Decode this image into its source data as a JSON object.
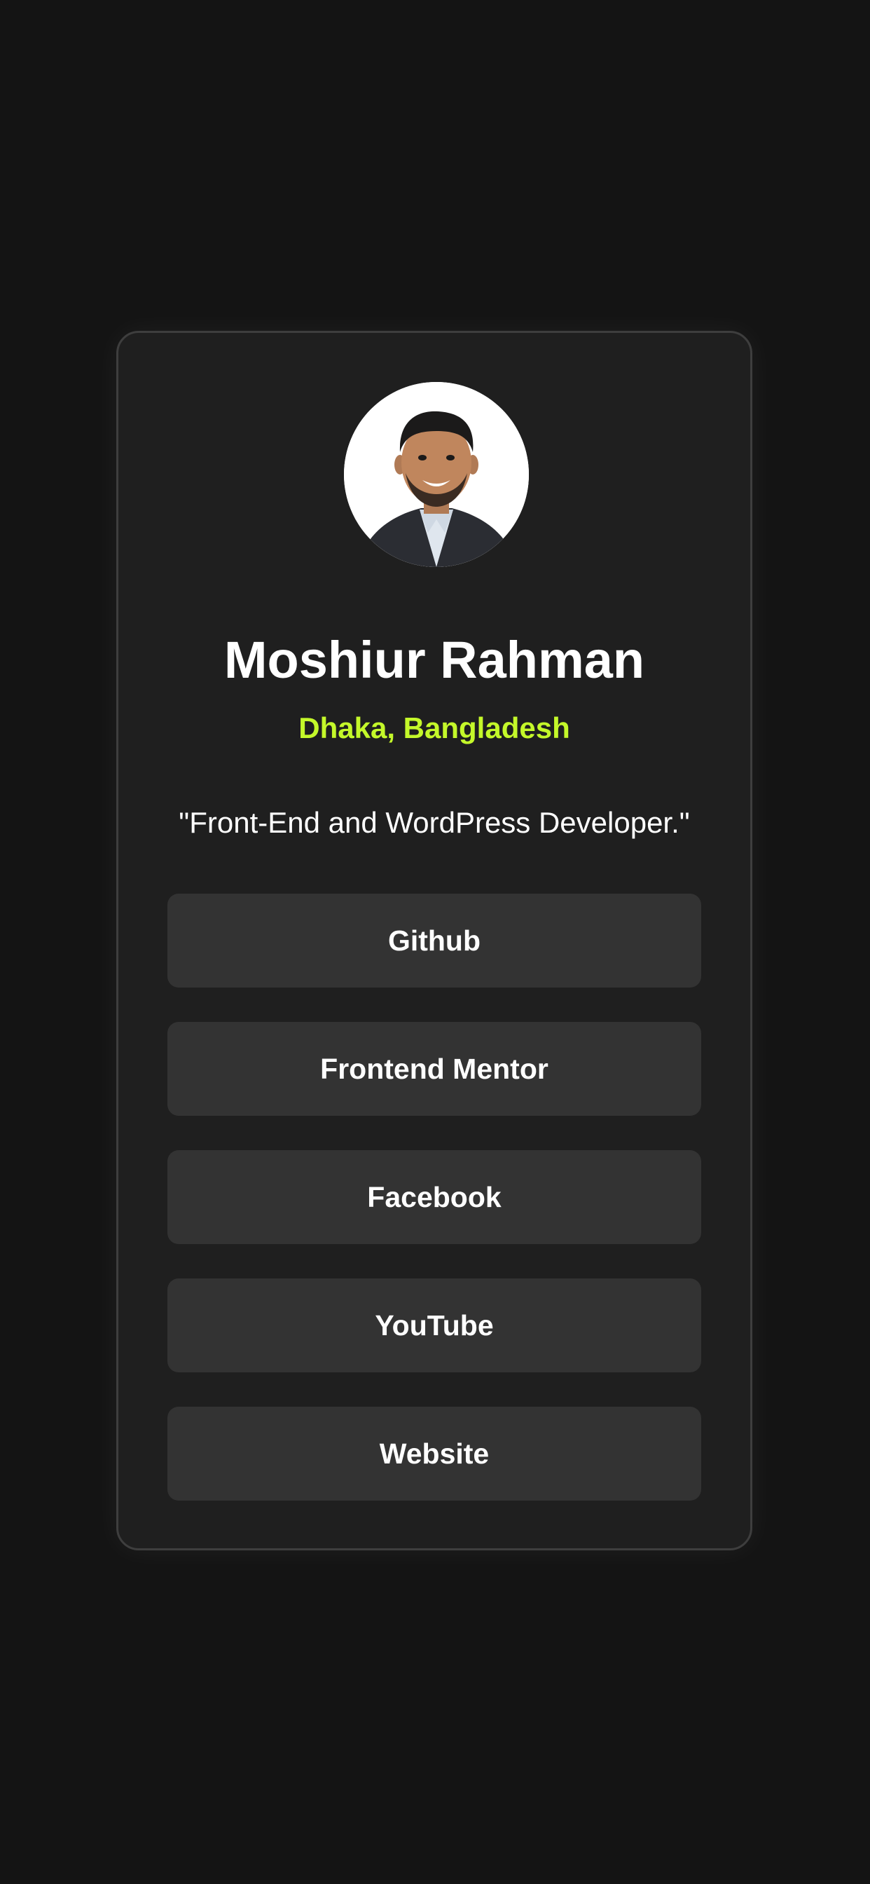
{
  "profile": {
    "name": "Moshiur Rahman",
    "location": "Dhaka, Bangladesh",
    "bio": "\"Front-End and WordPress Developer.\""
  },
  "links": [
    {
      "label": "Github"
    },
    {
      "label": "Frontend Mentor"
    },
    {
      "label": "Facebook"
    },
    {
      "label": "YouTube"
    },
    {
      "label": "Website"
    }
  ],
  "colors": {
    "background": "#141414",
    "card": "#1f1f1f",
    "button": "#333333",
    "accent": "#c4f82a",
    "text": "#ffffff"
  }
}
